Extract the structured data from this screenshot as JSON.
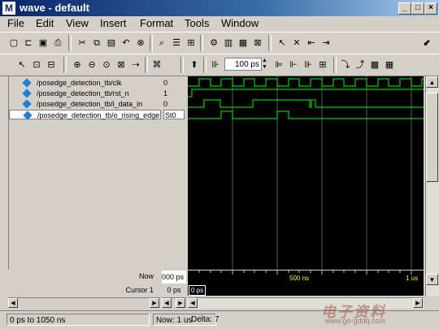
{
  "window": {
    "title": "wave - default"
  },
  "menu": [
    "File",
    "Edit",
    "View",
    "Insert",
    "Format",
    "Tools",
    "Window"
  ],
  "toolbar": {
    "zoom_value": "100 ps"
  },
  "signals": [
    {
      "name": "/posedge_detection_tb/clk",
      "value": "0"
    },
    {
      "name": "/posedge_detection_tb/rst_n",
      "value": "1"
    },
    {
      "name": "/posedge_detection_tb/i_data_in",
      "value": "0"
    },
    {
      "name": "/posedge_detection_tb/o_rising_edge",
      "value": "St0",
      "selected": true
    }
  ],
  "timeline": {
    "now_label": "Now",
    "now_value": "000 ps",
    "cursor_label": "Cursor 1",
    "cursor_value": "0 ps",
    "cursor_flag": "0 ps",
    "tick_500": "500 ns",
    "tick_1us": "1 us"
  },
  "status": {
    "range": "0 ps to 1050 ns",
    "now": "Now: 1 us",
    "delta": "Delta: 7"
  },
  "watermark": {
    "text": "电子资料",
    "url": "www.go-gddq.com"
  },
  "colors": {
    "wave": "#00ff00",
    "background": "#000000",
    "title_bar": "#0a246a"
  }
}
